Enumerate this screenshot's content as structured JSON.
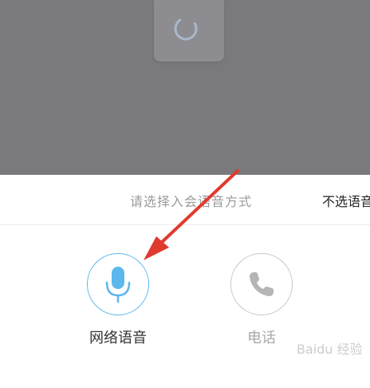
{
  "sheet": {
    "title": "请选择入会语音方式",
    "no_voice_label": "不选语音"
  },
  "options": [
    {
      "label": "网络语音",
      "icon": "microphone-icon",
      "selected": true
    },
    {
      "label": "电话",
      "icon": "phone-icon",
      "selected": false
    }
  ],
  "watermark": "Baidu 经验",
  "colors": {
    "overlay": "#7a797d",
    "accent": "#5cb8ec",
    "arrow": "#e03a2f",
    "inactive": "#c8c8c8"
  }
}
